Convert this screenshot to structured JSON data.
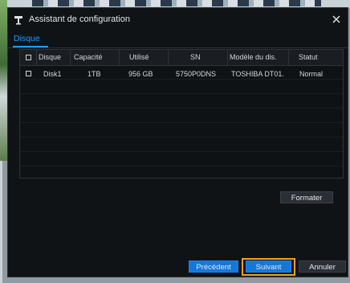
{
  "dialog": {
    "title": "Assistant de configuration",
    "tab": "Disque"
  },
  "table": {
    "headers": [
      "Disque",
      "Capacité",
      "Utilisé",
      "SN",
      "Modèle du dis.",
      "Statut"
    ],
    "rows": [
      {
        "disk": "Disk1",
        "capacity": "1TB",
        "used": "956 GB",
        "sn": "5750P0DNS",
        "model": "TOSHIBA DT01.",
        "status": "Normal"
      }
    ]
  },
  "buttons": {
    "format": "Formater",
    "previous": "Précédent",
    "next": "Suivant",
    "cancel": "Annuler"
  },
  "colors": {
    "accent": "#1aa0ff",
    "primary_button": "#1577d8",
    "highlight": "#f2a21b",
    "dialog_bg": "#101316"
  },
  "icons": {
    "title": "wizard-icon",
    "close": "close-icon"
  }
}
